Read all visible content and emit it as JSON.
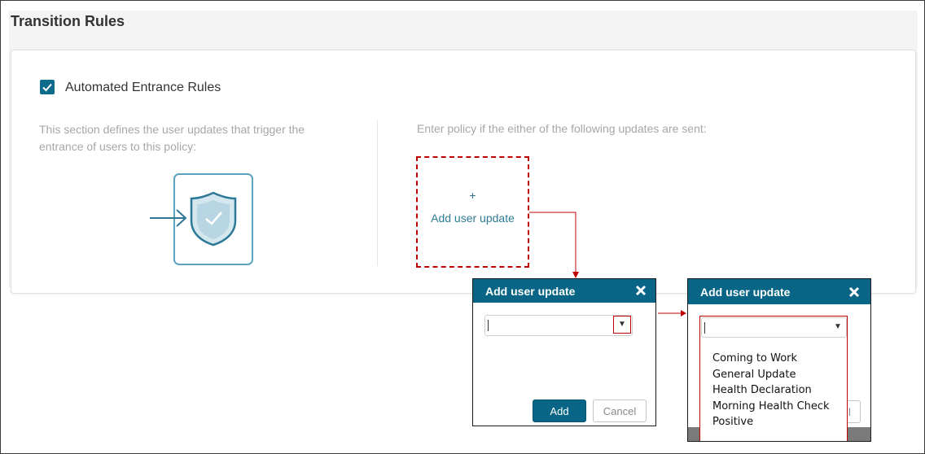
{
  "page": {
    "title": "Transition Rules"
  },
  "entrance": {
    "checkbox_label": "Automated Entrance Rules",
    "checked": true,
    "description": "This section defines the user updates that trigger the entrance of users to this policy:",
    "policy_text": "Enter policy if the either of the following updates are sent:",
    "add_tile": {
      "plus": "+",
      "label": "Add user update"
    }
  },
  "dialog_closed": {
    "title": "Add user update",
    "select_value": "",
    "add_label": "Add",
    "cancel_label": "Cancel"
  },
  "dialog_open": {
    "title": "Add user update",
    "select_value": "",
    "cancel_fragment": "l",
    "options": [
      "Coming to Work",
      "General Update",
      "Health Declaration",
      "Morning Health Check",
      "Positive"
    ]
  },
  "icons": {
    "checkbox": "check-icon",
    "illustration": "shield-check-entry-icon",
    "close": "close-icon",
    "dropdown": "chevron-down-icon"
  },
  "colors": {
    "primary": "#086585",
    "highlight": "#c00000",
    "muted_text": "#a7a7a7",
    "illustration": "#5ba3c0"
  }
}
